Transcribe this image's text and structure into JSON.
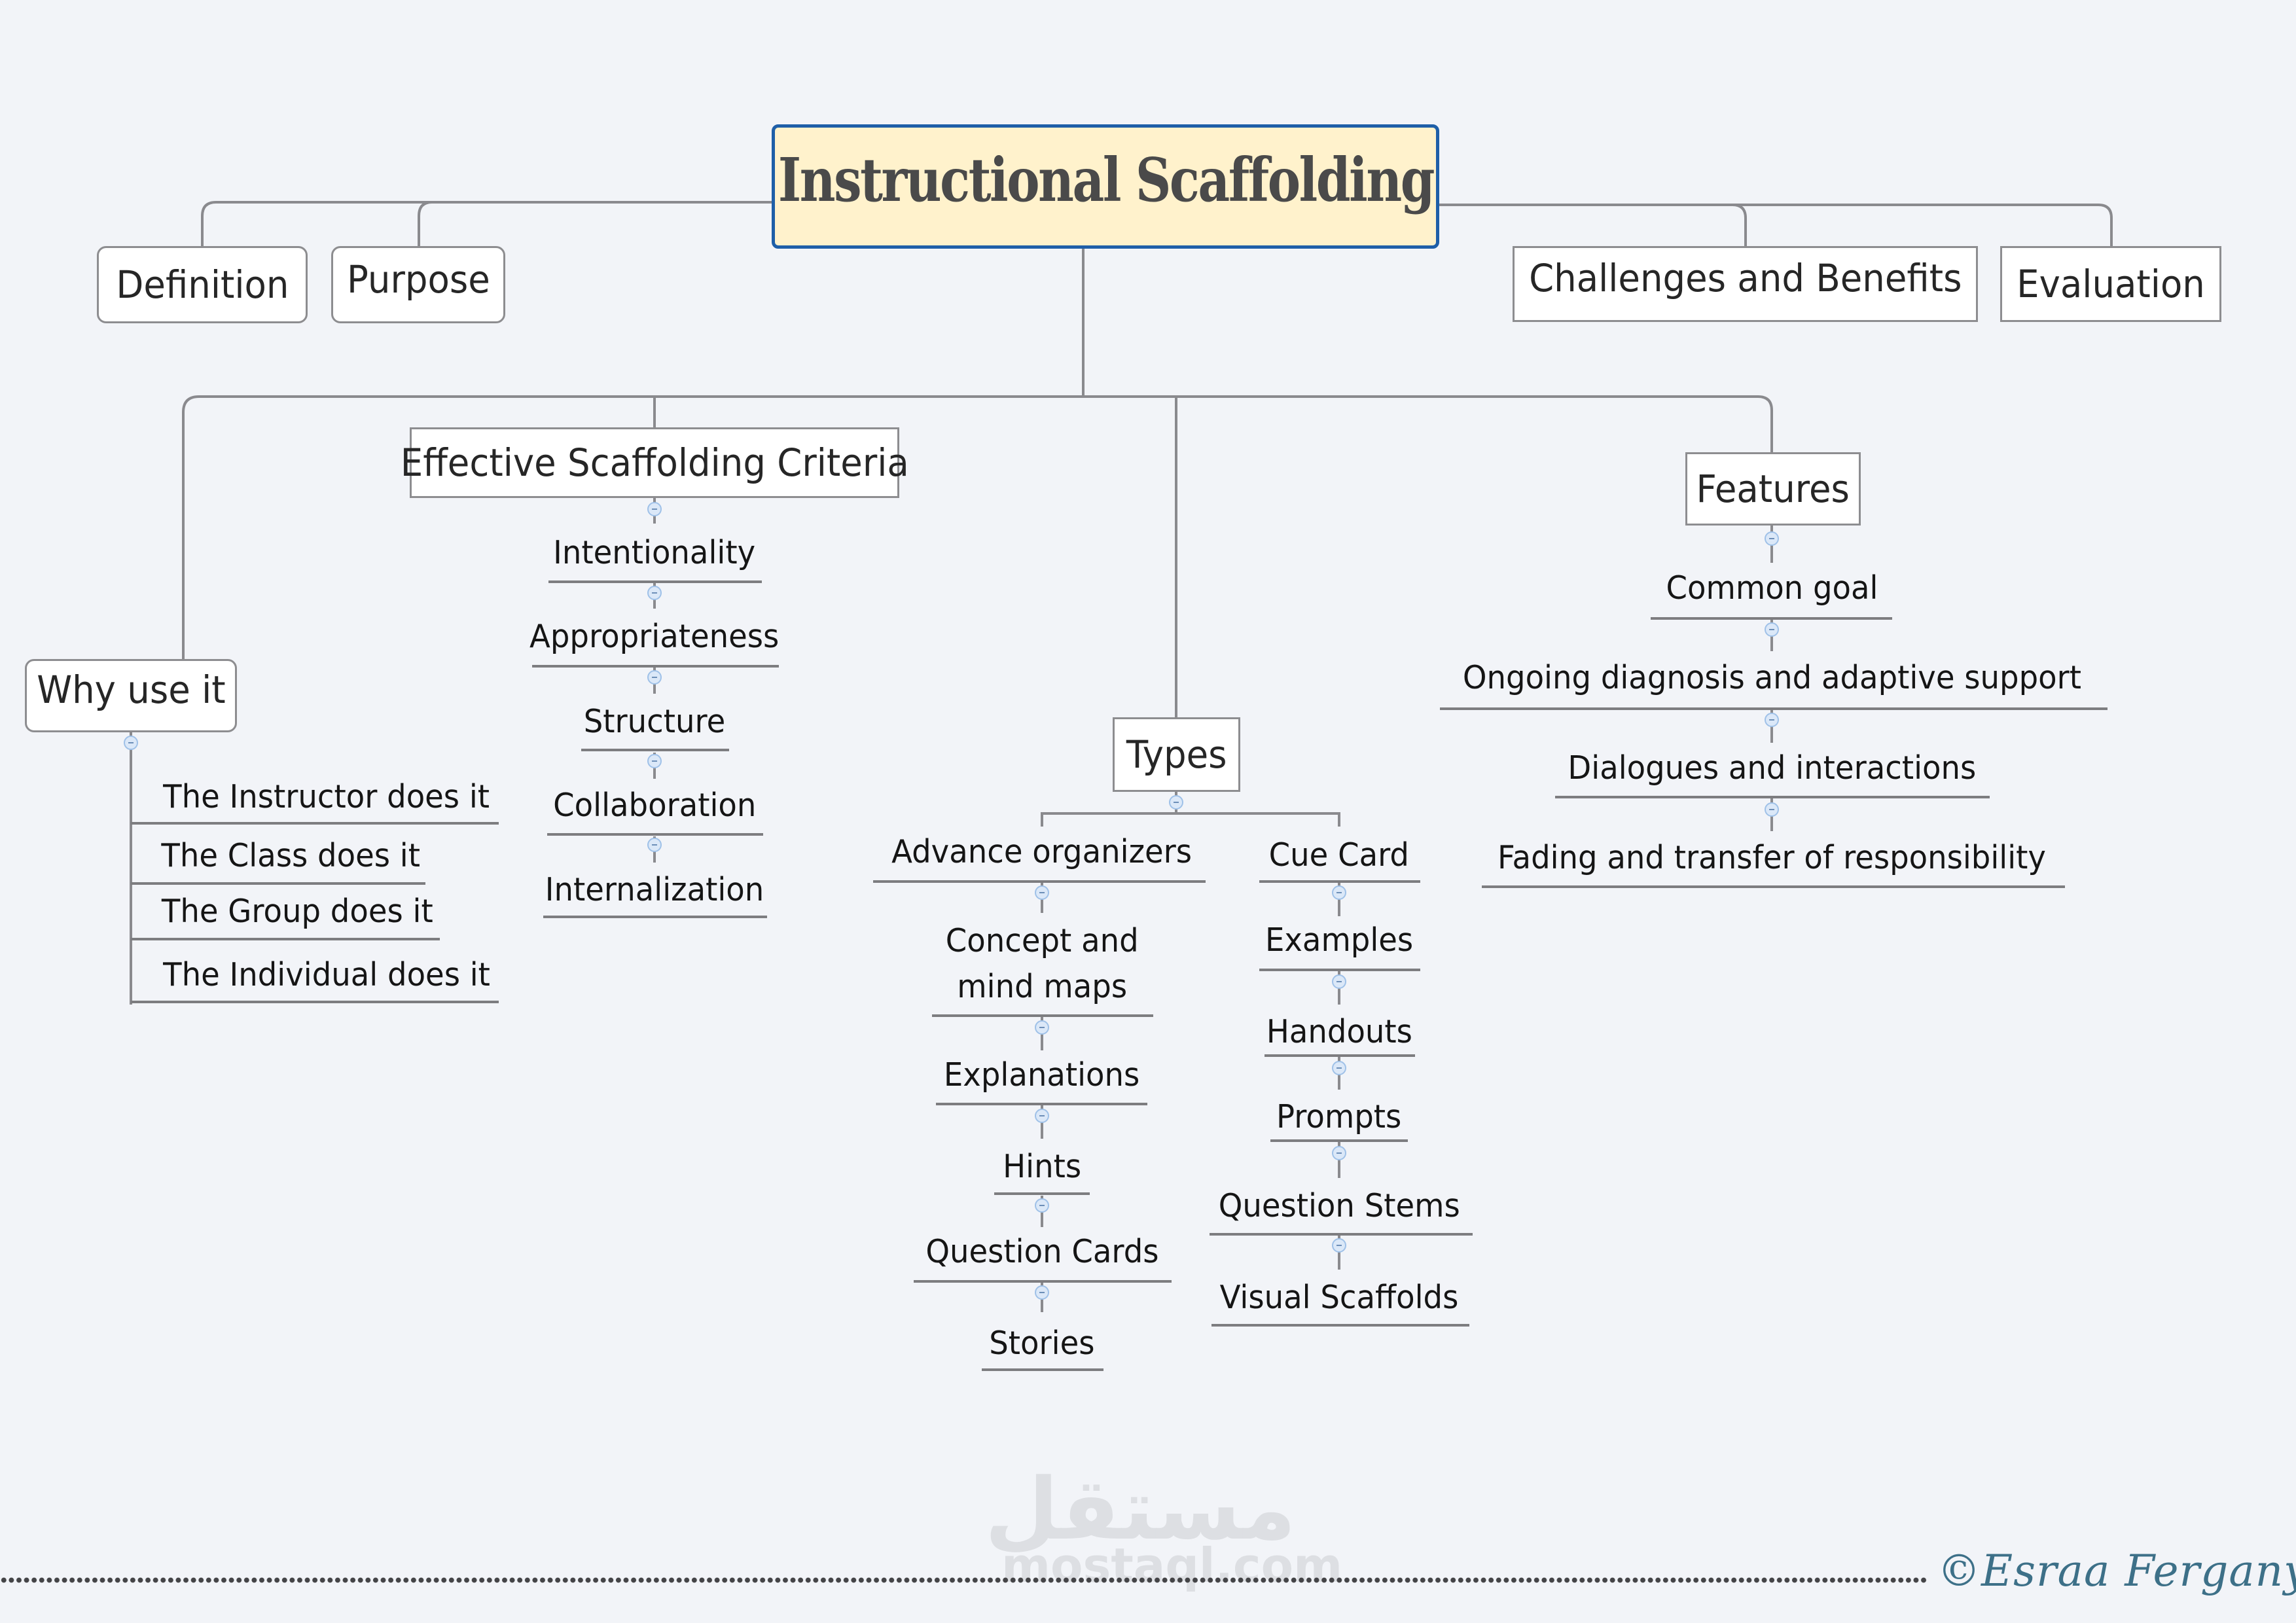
{
  "central_topic": "Instructional Scaffolding",
  "top_branches": {
    "definition": "Definition",
    "purpose": "Purpose",
    "challenges": "Challenges and Benefits",
    "evaluation": "Evaluation"
  },
  "why_use_it": {
    "title": "Why use it",
    "items": [
      "The Instructor does it",
      "The Class does it",
      "The Group does it",
      "The Individual does it"
    ]
  },
  "criteria": {
    "title": "Effective Scaffolding Criteria",
    "items": [
      "Intentionality",
      "Appropriateness",
      "Structure",
      "Collaboration",
      "Internalization"
    ]
  },
  "types": {
    "title": "Types",
    "left_column": [
      "Advance organizers",
      "Concept and\nmind maps",
      "Explanations",
      "Hints",
      "Question Cards",
      "Stories"
    ],
    "right_column": [
      "Cue Card",
      "Examples",
      "Handouts",
      "Prompts",
      "Question Stems",
      "Visual Scaffolds"
    ]
  },
  "features": {
    "title": "Features",
    "items": [
      "Common goal",
      "Ongoing diagnosis and adaptive support",
      "Dialogues and interactions",
      "Fading and transfer of responsibility"
    ]
  },
  "footer": {
    "watermark_arabic": "مستقل",
    "watermark_latin": "mostaql.com",
    "signature": "©Esraa Fergany"
  },
  "colors": {
    "central_fill": "#fff2cc",
    "central_border": "#1f5fa8",
    "signature": "#3d7088",
    "background": "#f2f4f8"
  }
}
